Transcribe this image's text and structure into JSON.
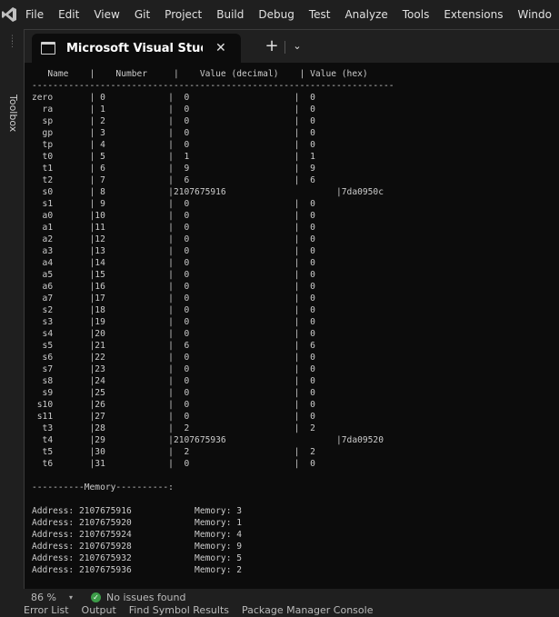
{
  "menu": [
    "File",
    "Edit",
    "View",
    "Git",
    "Project",
    "Build",
    "Debug",
    "Test",
    "Analyze",
    "Tools",
    "Extensions",
    "Windo"
  ],
  "sidebar": {
    "toolbox_label": "Toolbox"
  },
  "console": {
    "tab_title": "Microsoft Visual Studio Debu",
    "header": "   Name    |    Number     |    Value (decimal)    | Value (hex)",
    "separator": "---------------------------------------------------------------------",
    "registers": [
      "zero       | 0            |  0                    |  0",
      "  ra       | 1            |  0                    |  0",
      "  sp       | 2            |  0                    |  0",
      "  gp       | 3            |  0                    |  0",
      "  tp       | 4            |  0                    |  0",
      "  t0       | 5            |  1                    |  1",
      "  t1       | 6            |  9                    |  9",
      "  t2       | 7            |  6                    |  6",
      "  s0       | 8            |2107675916                     |7da0950c",
      "  s1       | 9            |  0                    |  0",
      "  a0       |10            |  0                    |  0",
      "  a1       |11            |  0                    |  0",
      "  a2       |12            |  0                    |  0",
      "  a3       |13            |  0                    |  0",
      "  a4       |14            |  0                    |  0",
      "  a5       |15            |  0                    |  0",
      "  a6       |16            |  0                    |  0",
      "  a7       |17            |  0                    |  0",
      "  s2       |18            |  0                    |  0",
      "  s3       |19            |  0                    |  0",
      "  s4       |20            |  0                    |  0",
      "  s5       |21            |  6                    |  6",
      "  s6       |22            |  0                    |  0",
      "  s7       |23            |  0                    |  0",
      "  s8       |24            |  0                    |  0",
      "  s9       |25            |  0                    |  0",
      " s10       |26            |  0                    |  0",
      " s11       |27            |  0                    |  0",
      "  t3       |28            |  2                    |  2",
      "  t4       |29            |2107675936                     |7da09520",
      "  t5       |30            |  2                    |  2",
      "  t6       |31            |  0                    |  0"
    ],
    "memory_header": "----------Memory----------:",
    "memory": [
      "Address: 2107675916            Memory: 3",
      "Address: 2107675920            Memory: 1",
      "Address: 2107675924            Memory: 4",
      "Address: 2107675928            Memory: 9",
      "Address: 2107675932            Memory: 5",
      "Address: 2107675936            Memory: 2"
    ]
  },
  "status": {
    "zoom": "86 %",
    "issues": "No issues found"
  },
  "bottom_tabs": [
    "Error List",
    "Output",
    "Find Symbol Results",
    "Package Manager Console"
  ]
}
